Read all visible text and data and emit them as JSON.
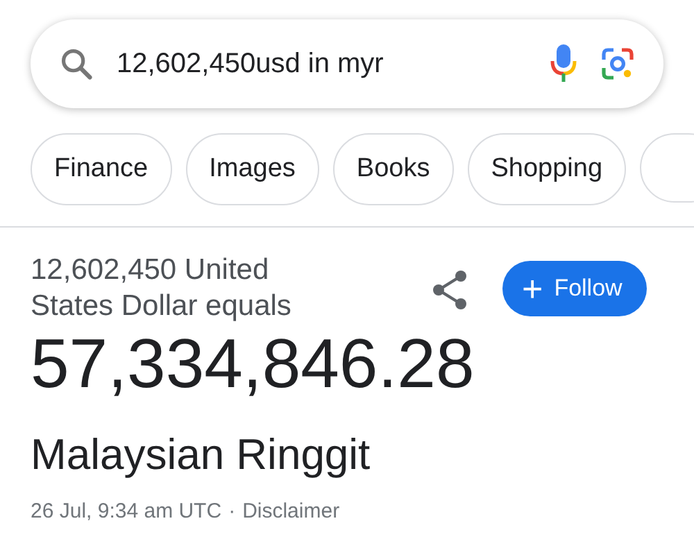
{
  "search": {
    "value": "12,602,450usd in myr"
  },
  "chips": [
    {
      "label": "Finance"
    },
    {
      "label": "Images"
    },
    {
      "label": "Books"
    },
    {
      "label": "Shopping"
    },
    {
      "kind": "partial"
    }
  ],
  "result": {
    "from": "12,602,450 United States Dollar equals",
    "amount": "57,334,846.28",
    "currency": "Malaysian Ringgit",
    "follow": "Follow",
    "follow_icon": "+",
    "date": "26 Jul, 9:34 am UTC",
    "separator": "·",
    "disclaimer": "Disclaimer"
  }
}
